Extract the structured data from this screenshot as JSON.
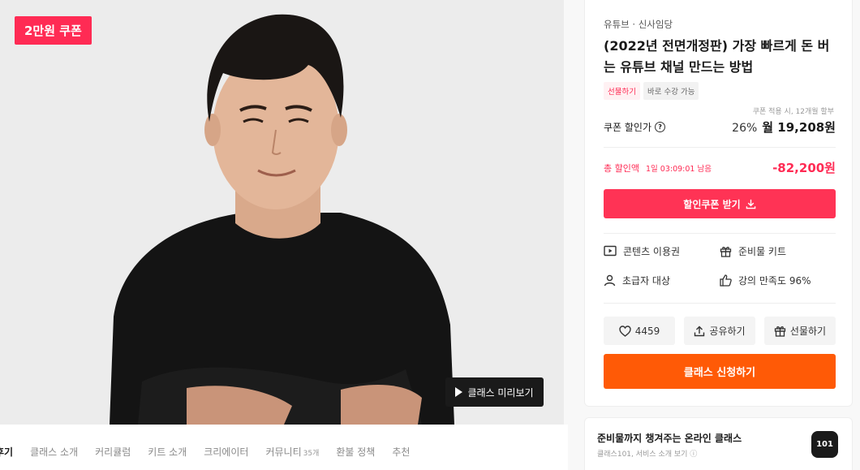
{
  "hero": {
    "badge": "2만원 쿠폰",
    "preview_label": "클래스 미리보기"
  },
  "tabs": [
    {
      "label": "후기"
    },
    {
      "label": "클래스 소개"
    },
    {
      "label": "커리큘럼"
    },
    {
      "label": "키트 소개"
    },
    {
      "label": "크리에이터"
    },
    {
      "label": "커뮤니티",
      "count": "35개"
    },
    {
      "label": "환불 정책"
    },
    {
      "label": "추천"
    }
  ],
  "panel": {
    "category": "유튜브 · 신사임당",
    "title": "(2022년 전면개정판) 가장 빠르게 돈 버는 유튜브 채널 만드는 방법",
    "chips": [
      "선물하기",
      "바로 수강 가능"
    ],
    "coupon_note": "쿠폰 적용 시, 12개월 할부",
    "price_label": "쿠폰 할인가",
    "discount_percent": "26%",
    "monthly_price": "월 19,208원",
    "total_discount_label": "총 할인액",
    "timer": "1일 03:09:01 남음",
    "total_discount": "-82,200원",
    "coupon_button": "할인쿠폰 받기",
    "features": [
      {
        "icon": "play-box-icon",
        "label": "콘텐츠 이용권"
      },
      {
        "icon": "gift-icon",
        "label": "준비물 키트"
      },
      {
        "icon": "person-icon",
        "label": "초급자 대상"
      },
      {
        "icon": "thumbs-up-icon",
        "label": "강의 만족도 96%"
      }
    ],
    "like_count": "4459",
    "share_label": "공유하기",
    "gift_label": "선물하기",
    "apply_button": "클래스 신청하기"
  },
  "promo": {
    "title": "준비물까지 챙겨주는 온라인 클래스",
    "subtitle": "클래스101, 서비스 소개 보기",
    "logo": "101"
  },
  "colors": {
    "accent_red": "#ff3355",
    "accent_orange": "#ff5a06"
  }
}
